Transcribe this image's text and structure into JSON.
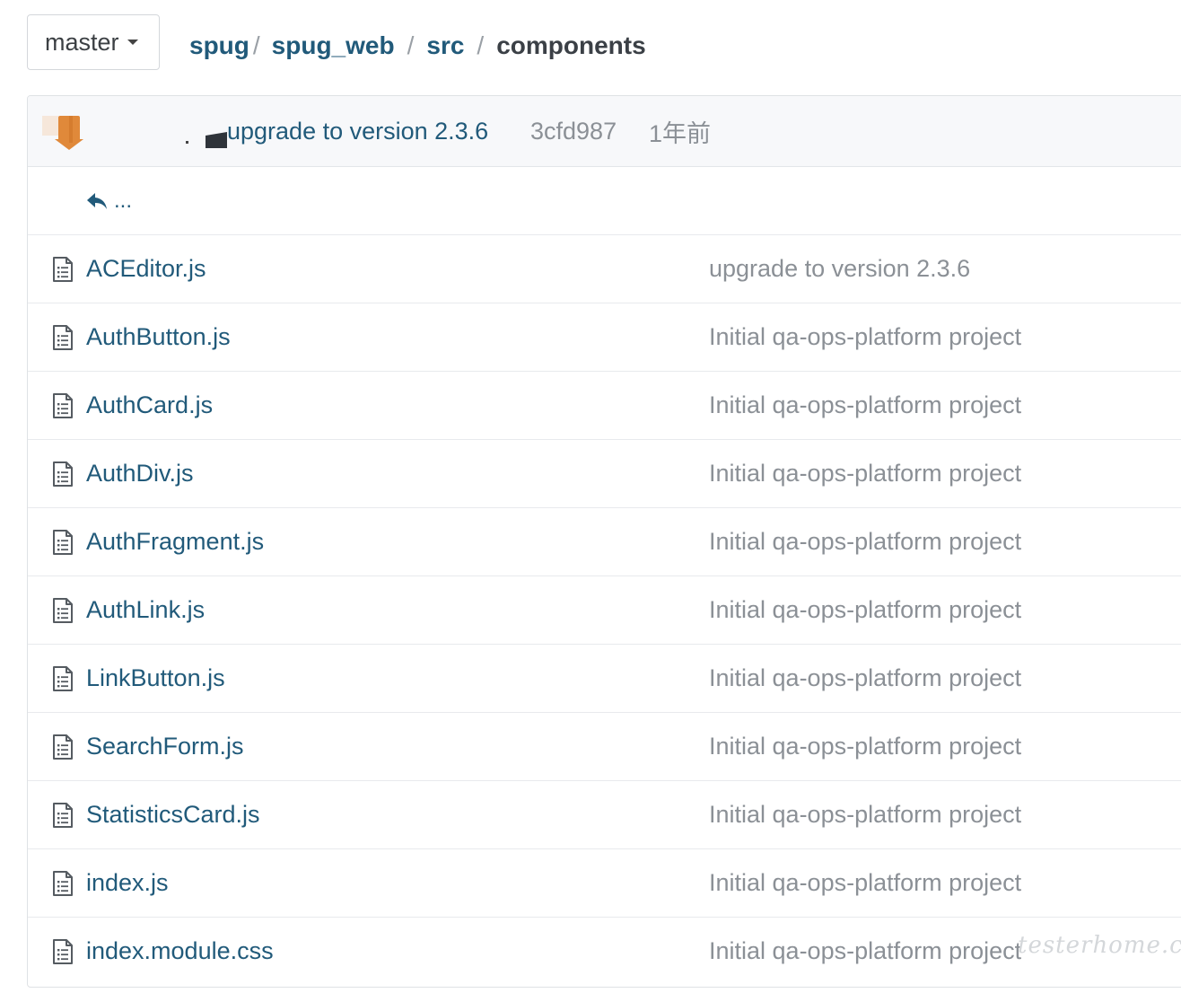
{
  "branch": {
    "name": "master"
  },
  "breadcrumb": {
    "repo": "spug",
    "folders": [
      "spug_web",
      "src"
    ],
    "current": "components",
    "separator": "/"
  },
  "commit": {
    "message": "upgrade to version 2.3.6",
    "sha": "3cfd987",
    "time": "1年前"
  },
  "parent_link": {
    "label": "..."
  },
  "files": [
    {
      "name": "ACEditor.js",
      "message": "upgrade to version 2.3.6"
    },
    {
      "name": "AuthButton.js",
      "message": "Initial qa-ops-platform project"
    },
    {
      "name": "AuthCard.js",
      "message": "Initial qa-ops-platform project"
    },
    {
      "name": "AuthDiv.js",
      "message": "Initial qa-ops-platform project"
    },
    {
      "name": "AuthFragment.js",
      "message": "Initial qa-ops-platform project"
    },
    {
      "name": "AuthLink.js",
      "message": "Initial qa-ops-platform project"
    },
    {
      "name": "LinkButton.js",
      "message": "Initial qa-ops-platform project"
    },
    {
      "name": "SearchForm.js",
      "message": "Initial qa-ops-platform project"
    },
    {
      "name": "StatisticsCard.js",
      "message": "Initial qa-ops-platform project"
    },
    {
      "name": "index.js",
      "message": "Initial qa-ops-platform project"
    },
    {
      "name": "index.module.css",
      "message": "Initial qa-ops-platform project"
    }
  ],
  "watermark": "testerhome.com",
  "colors": {
    "link": "#215a7a",
    "muted": "#8b9096",
    "header_bg": "#f7f8fa"
  },
  "icons": {
    "file": "file-text-icon",
    "parent": "reply-arrow-icon",
    "caret": "caret-down-icon"
  }
}
